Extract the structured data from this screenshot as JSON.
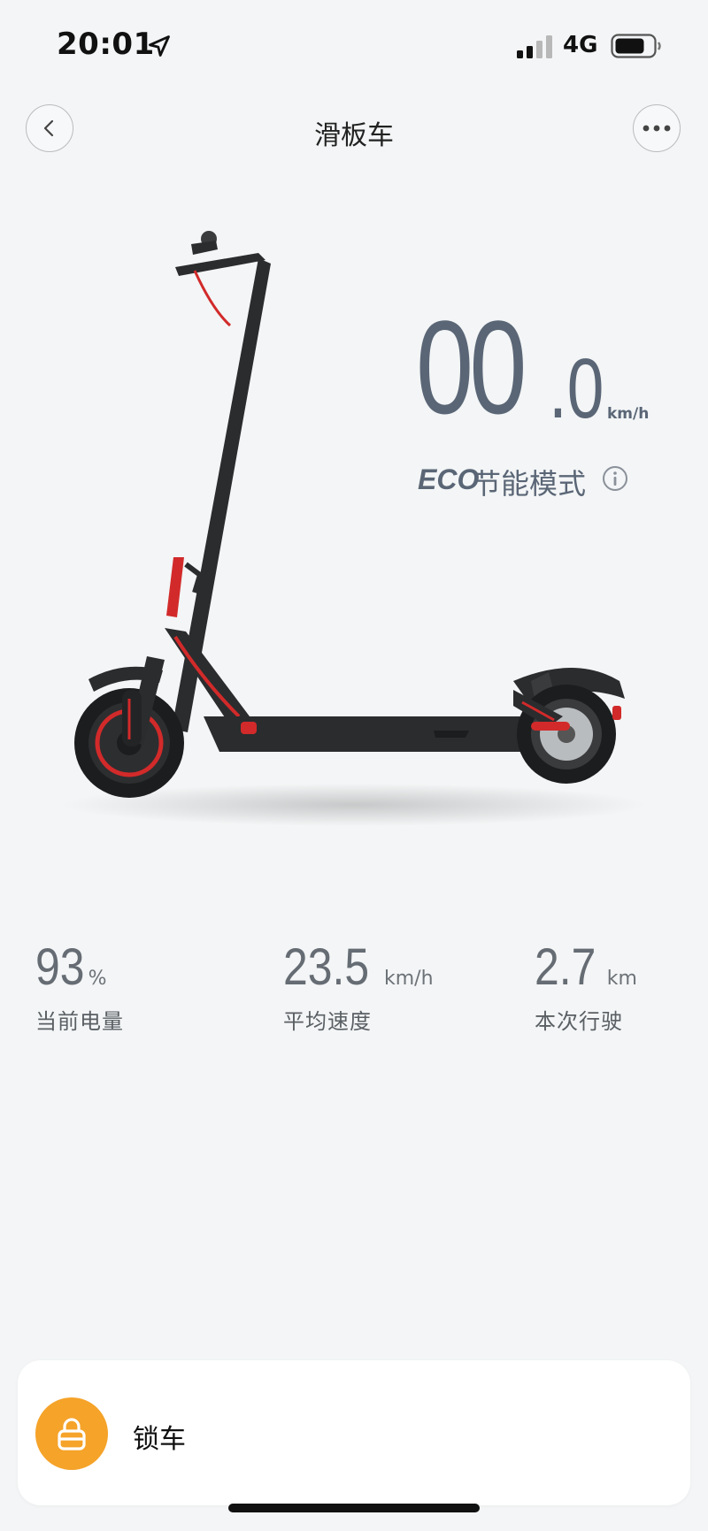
{
  "status_bar": {
    "time": "20:01",
    "network": "4G"
  },
  "nav": {
    "title": "滑板车"
  },
  "speed": {
    "integer": "00",
    "decimal": ".0",
    "unit": "km/h"
  },
  "mode": {
    "badge": "ECO",
    "label": "节能模式"
  },
  "stats": [
    {
      "value": "93",
      "unit": "%",
      "label": "当前电量"
    },
    {
      "value": "23.5",
      "unit": "km/h",
      "label": "平均速度"
    },
    {
      "value": "2.7",
      "unit": "km",
      "label": "本次行驶"
    }
  ],
  "lock": {
    "label": "锁车"
  },
  "colors": {
    "accent": "#f5a329",
    "speed_text": "#5a6676",
    "background": "#f3f5f6"
  }
}
